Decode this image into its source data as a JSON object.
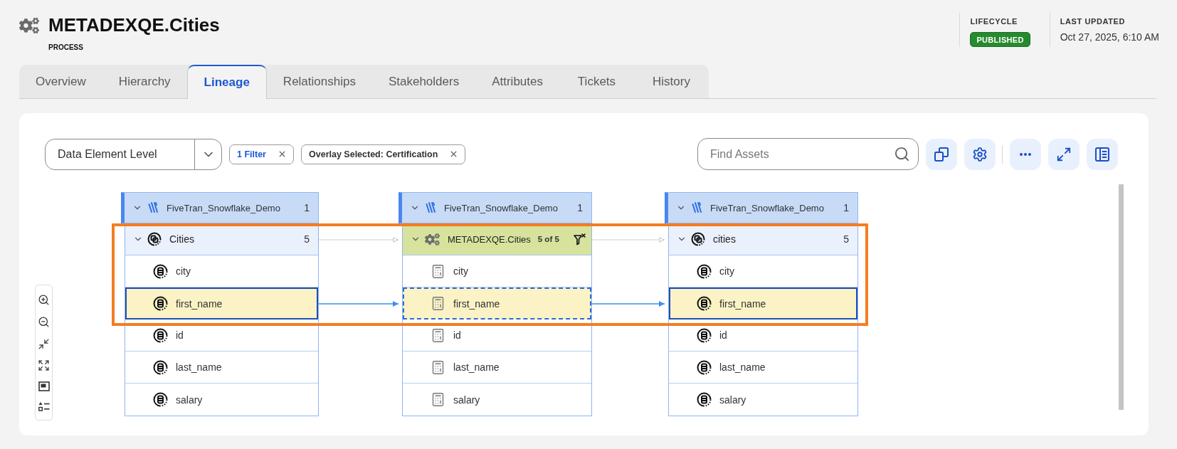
{
  "header": {
    "title": "METADEXQE.Cities",
    "type": "PROCESS",
    "lifecycle": {
      "label": "LIFECYCLE",
      "status": "PUBLISHED"
    },
    "last_updated": {
      "label": "LAST UPDATED",
      "value": "Oct 27, 2025, 6:10 AM"
    }
  },
  "tabs": [
    {
      "label": "Overview",
      "selected": false
    },
    {
      "label": "Hierarchy",
      "selected": false
    },
    {
      "label": "Lineage",
      "selected": true
    },
    {
      "label": "Relationships",
      "selected": false
    },
    {
      "label": "Stakeholders",
      "selected": false
    },
    {
      "label": "Attributes",
      "selected": false
    },
    {
      "label": "Tickets",
      "selected": false
    },
    {
      "label": "History",
      "selected": false
    }
  ],
  "toolbar": {
    "level_select": {
      "value": "Data Element Level"
    },
    "chips": [
      {
        "label": "1 Filter",
        "kind": "filter"
      },
      {
        "label": "Overlay Selected: Certification",
        "kind": "overlay"
      }
    ],
    "search": {
      "placeholder": "Find Assets"
    }
  },
  "lineage": {
    "columns": [
      {
        "kind": "table",
        "system": {
          "name": "FiveTran_Snowflake_Demo",
          "count": "1",
          "expanded": true
        },
        "asset": {
          "name": "Cities",
          "count": "5",
          "expanded": true
        },
        "fields": [
          {
            "name": "city",
            "selected": false
          },
          {
            "name": "first_name",
            "selected": true
          },
          {
            "name": "id",
            "selected": false
          },
          {
            "name": "last_name",
            "selected": false
          },
          {
            "name": "salary",
            "selected": false
          }
        ]
      },
      {
        "kind": "process",
        "system": {
          "name": "FiveTran_Snowflake_Demo",
          "count": "1",
          "expanded": true
        },
        "asset": {
          "name": "METADEXQE.Cities",
          "count": "5 of 5",
          "expanded": true
        },
        "fields": [
          {
            "name": "city",
            "selected": false
          },
          {
            "name": "first_name",
            "selected": true
          },
          {
            "name": "id",
            "selected": false
          },
          {
            "name": "last_name",
            "selected": false
          },
          {
            "name": "salary",
            "selected": false
          }
        ]
      },
      {
        "kind": "table",
        "system": {
          "name": "FiveTran_Snowflake_Demo",
          "count": "1",
          "expanded": true
        },
        "asset": {
          "name": "cities",
          "count": "5",
          "expanded": true
        },
        "fields": [
          {
            "name": "city",
            "selected": false
          },
          {
            "name": "first_name",
            "selected": true
          },
          {
            "name": "id",
            "selected": false
          },
          {
            "name": "last_name",
            "selected": false
          },
          {
            "name": "salary",
            "selected": false
          }
        ]
      }
    ]
  }
}
